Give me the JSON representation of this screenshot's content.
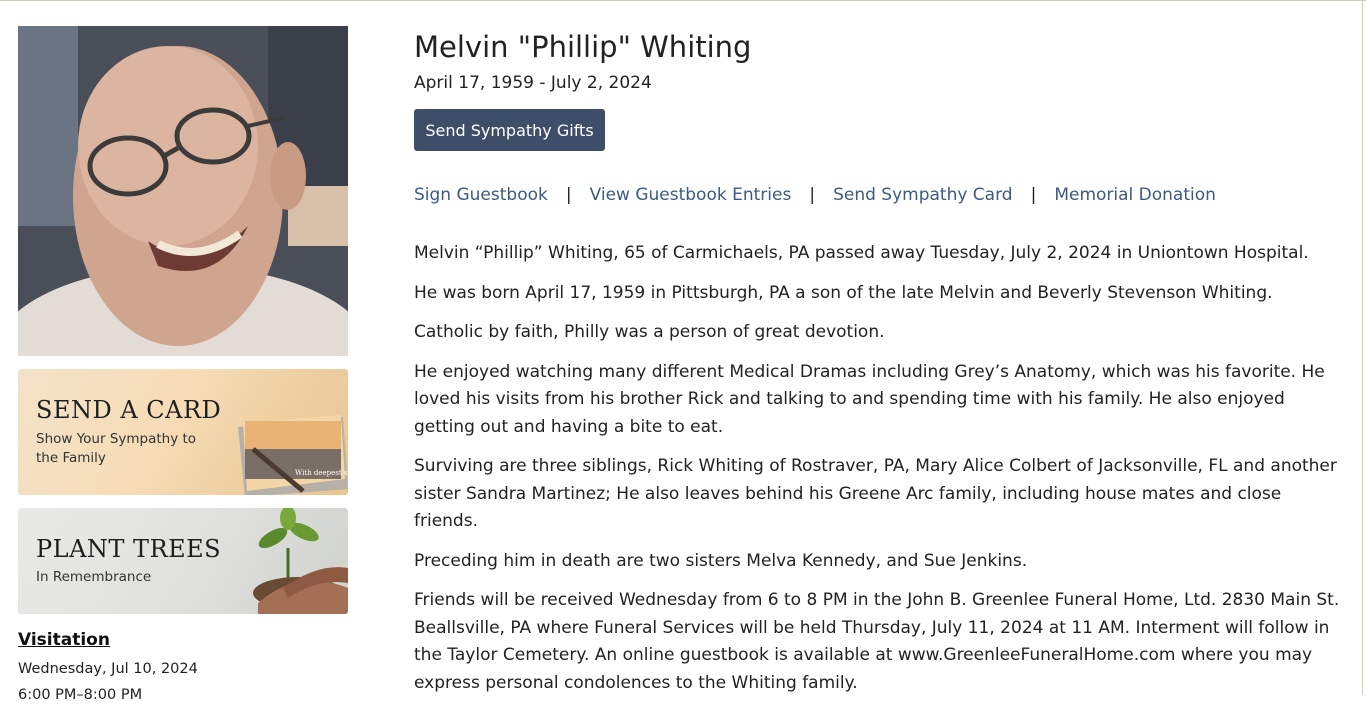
{
  "person": {
    "name": "Melvin \"Phillip\" Whiting",
    "dates": "April 17, 1959 - July 2, 2024"
  },
  "actions": {
    "gift_button": "Send Sympathy Gifts"
  },
  "nav_links": [
    "Sign Guestbook",
    "View Guestbook Entries",
    "Send Sympathy Card",
    "Memorial Donation"
  ],
  "nav_separator": "|",
  "obituary": [
    "Melvin “Phillip” Whiting, 65 of Carmichaels, PA passed away Tuesday, July 2, 2024 in Uniontown Hospital.",
    "He was born April 17, 1959 in Pittsburgh, PA a son of the late Melvin and Beverly Stevenson Whiting.",
    "Catholic by faith, Philly was a person of great devotion.",
    "He enjoyed watching many different Medical Dramas including Grey’s Anatomy, which was his favorite. He loved his visits from his brother Rick and talking to and spending time with his family.  He also enjoyed getting out and having a bite to eat.",
    "Surviving are three siblings, Rick Whiting of Rostraver, PA, Mary Alice Colbert of Jacksonville, FL and another sister Sandra Martinez; He also leaves behind his Greene Arc family, including house mates and close friends.",
    "Preceding him in death are two sisters Melva Kennedy, and Sue Jenkins.",
    "Friends will be received Wednesday from 6 to 8 PM in the John B. Greenlee Funeral Home, Ltd. 2830 Main St. Beallsville, PA where Funeral Services will be held Thursday, July 11, 2024 at 11 AM. Interment will follow in the Taylor Cemetery. An online guestbook is available at www.GreenleeFuneralHome.com where you may express personal condolences to the Whiting family."
  ],
  "promos": {
    "card": {
      "title": "SEND A CARD",
      "subtitle": "Show Your Sympathy to the Family",
      "card_text": "With deepest sympathy"
    },
    "trees": {
      "title": "PLANT TREES",
      "subtitle": "In Remembrance"
    }
  },
  "visitation": {
    "heading": "Visitation",
    "date": "Wednesday, Jul 10, 2024",
    "time": "6:00 PM–8:00 PM"
  },
  "colors": {
    "button_bg": "#3d4f68",
    "link": "#3d5a80"
  }
}
